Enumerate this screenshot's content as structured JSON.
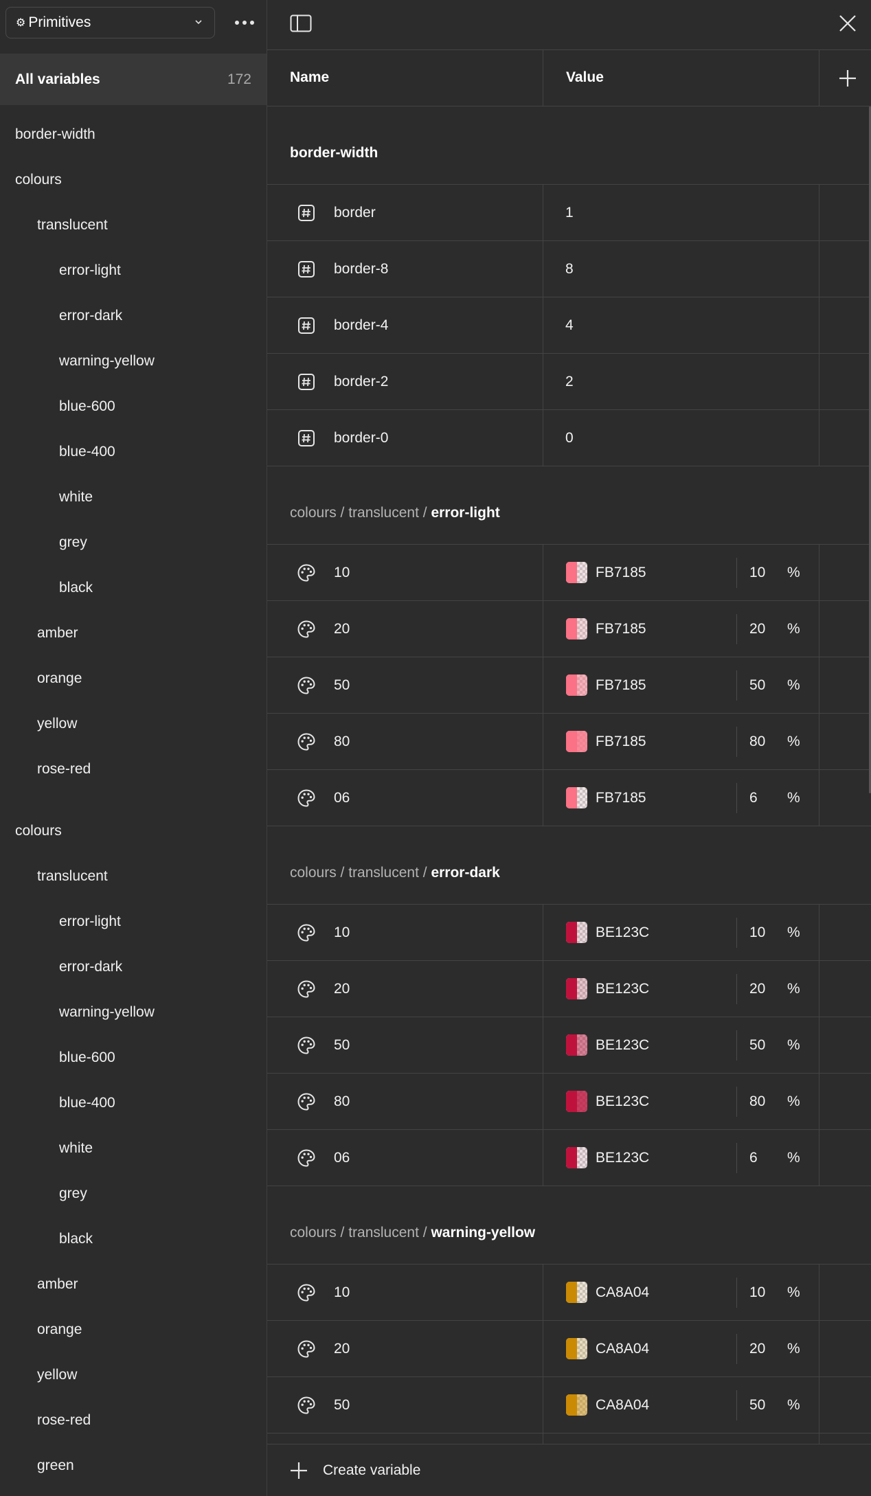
{
  "sidebar": {
    "collection": "Primitives",
    "all_variables_label": "All variables",
    "all_variables_count": "172",
    "tree": [
      {
        "label": "border-width",
        "level": 0
      },
      {
        "label": "colours",
        "level": 0
      },
      {
        "label": "translucent",
        "level": 1
      },
      {
        "label": "error-light",
        "level": 2
      },
      {
        "label": "error-dark",
        "level": 2
      },
      {
        "label": "warning-yellow",
        "level": 2
      },
      {
        "label": "blue-600",
        "level": 2
      },
      {
        "label": "blue-400",
        "level": 2
      },
      {
        "label": "white",
        "level": 2
      },
      {
        "label": "grey",
        "level": 2
      },
      {
        "label": "black",
        "level": 2
      },
      {
        "label": "amber",
        "level": 1
      },
      {
        "label": "orange",
        "level": 1
      },
      {
        "label": "yellow",
        "level": 1
      },
      {
        "label": "rose-red",
        "level": 1
      },
      {
        "label": "colours",
        "level": 0
      },
      {
        "label": "translucent",
        "level": 1
      },
      {
        "label": "error-light",
        "level": 2
      },
      {
        "label": "error-dark",
        "level": 2
      },
      {
        "label": "warning-yellow",
        "level": 2
      },
      {
        "label": "blue-600",
        "level": 2
      },
      {
        "label": "blue-400",
        "level": 2
      },
      {
        "label": "white",
        "level": 2
      },
      {
        "label": "grey",
        "level": 2
      },
      {
        "label": "black",
        "level": 2
      },
      {
        "label": "amber",
        "level": 1
      },
      {
        "label": "orange",
        "level": 1
      },
      {
        "label": "yellow",
        "level": 1
      },
      {
        "label": "rose-red",
        "level": 1
      },
      {
        "label": "green",
        "level": 1
      }
    ]
  },
  "table": {
    "name_header": "Name",
    "value_header": "Value",
    "groups": [
      {
        "path_prefix": "",
        "title": "border-width",
        "type": "number",
        "rows": [
          {
            "name": "border",
            "value": "1"
          },
          {
            "name": "border-8",
            "value": "8"
          },
          {
            "name": "border-4",
            "value": "4"
          },
          {
            "name": "border-2",
            "value": "2"
          },
          {
            "name": "border-0",
            "value": "0"
          }
        ]
      },
      {
        "path_prefix": "colours / translucent / ",
        "title": "error-light",
        "type": "color",
        "color": "#FB7185",
        "rows": [
          {
            "name": "10",
            "hex": "FB7185",
            "opacity": "10",
            "unit": "%"
          },
          {
            "name": "20",
            "hex": "FB7185",
            "opacity": "20",
            "unit": "%"
          },
          {
            "name": "50",
            "hex": "FB7185",
            "opacity": "50",
            "unit": "%"
          },
          {
            "name": "80",
            "hex": "FB7185",
            "opacity": "80",
            "unit": "%"
          },
          {
            "name": "06",
            "hex": "FB7185",
            "opacity": "6",
            "unit": "%"
          }
        ]
      },
      {
        "path_prefix": "colours / translucent / ",
        "title": "error-dark",
        "type": "color",
        "color": "#BE123C",
        "rows": [
          {
            "name": "10",
            "hex": "BE123C",
            "opacity": "10",
            "unit": "%"
          },
          {
            "name": "20",
            "hex": "BE123C",
            "opacity": "20",
            "unit": "%"
          },
          {
            "name": "50",
            "hex": "BE123C",
            "opacity": "50",
            "unit": "%"
          },
          {
            "name": "80",
            "hex": "BE123C",
            "opacity": "80",
            "unit": "%"
          },
          {
            "name": "06",
            "hex": "BE123C",
            "opacity": "6",
            "unit": "%"
          }
        ]
      },
      {
        "path_prefix": "colours / translucent / ",
        "title": "warning-yellow",
        "type": "color",
        "color": "#CA8A04",
        "rows": [
          {
            "name": "10",
            "hex": "CA8A04",
            "opacity": "10",
            "unit": "%"
          },
          {
            "name": "20",
            "hex": "CA8A04",
            "opacity": "20",
            "unit": "%"
          },
          {
            "name": "50",
            "hex": "CA8A04",
            "opacity": "50",
            "unit": "%"
          },
          {
            "name": "",
            "hex": "",
            "opacity": "",
            "unit": ""
          }
        ]
      }
    ]
  },
  "footer": {
    "create_label": "Create variable"
  },
  "icons": {
    "collection": "cog-icon",
    "number": "number-variable-icon",
    "color": "palette-icon"
  }
}
